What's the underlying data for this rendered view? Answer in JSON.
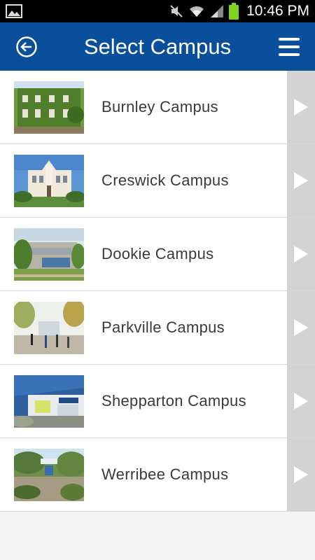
{
  "status_bar": {
    "time": "10:46 PM",
    "icons": [
      "gallery-icon",
      "mute-icon",
      "wifi-icon",
      "signal-icon",
      "battery-icon"
    ]
  },
  "header": {
    "title": "Select Campus",
    "back_icon": "back-circle-icon",
    "menu_icon": "hamburger-menu-icon",
    "color": "#0a4f9c"
  },
  "campuses": [
    {
      "label": "Burnley Campus"
    },
    {
      "label": "Creswick Campus"
    },
    {
      "label": "Dookie Campus"
    },
    {
      "label": "Parkville Campus"
    },
    {
      "label": "Shepparton Campus"
    },
    {
      "label": "Werribee Campus"
    }
  ]
}
